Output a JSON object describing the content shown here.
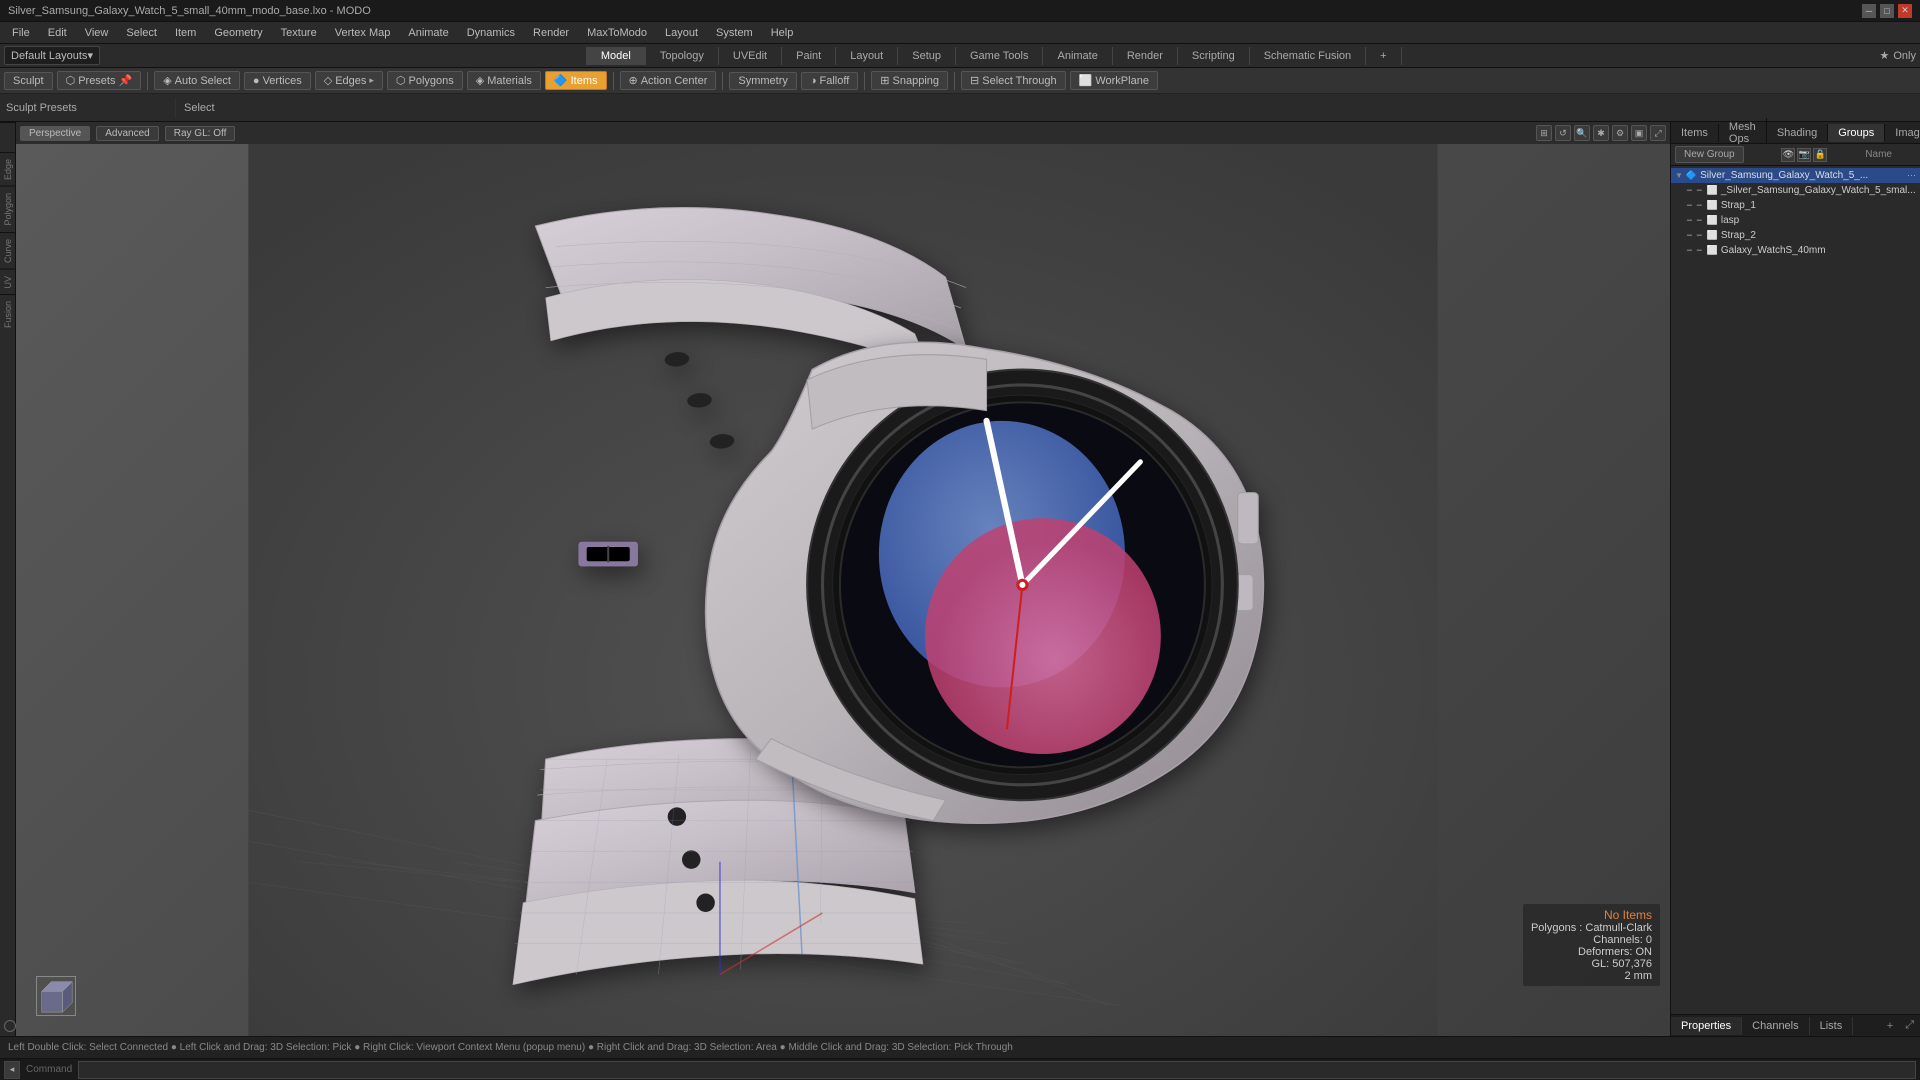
{
  "titleBar": {
    "title": "Silver_Samsung_Galaxy_Watch_5_small_40mm_modo_base.lxo - MODO",
    "minimize": "─",
    "maximize": "□",
    "close": "✕"
  },
  "menuBar": {
    "items": [
      "File",
      "Edit",
      "View",
      "Select",
      "Item",
      "Geometry",
      "Texture",
      "Vertex Map",
      "Animate",
      "Dynamics",
      "Render",
      "MaxToModo",
      "Layout",
      "System",
      "Help"
    ]
  },
  "layoutBar": {
    "defaultLayouts": "Default Layouts",
    "tabs": [
      "Model",
      "Topology",
      "UVEdit",
      "Paint",
      "Layout",
      "Setup",
      "Game Tools",
      "Animate",
      "Render",
      "Scripting",
      "Schematic Fusion"
    ],
    "activeTab": "Model",
    "star": "★",
    "onlyLabel": "Only"
  },
  "toolBar": {
    "sculpt": "Sculpt",
    "presets": "Presets",
    "autoSelect": "Auto Select",
    "vertices": "Vertices",
    "edges": "Edges",
    "polygons": "Polygons",
    "materials": "Materials",
    "items": "Items",
    "actionCenter": "Action Center",
    "symmetry": "Symmetry",
    "falloff": "Falloff",
    "snapping": "Snapping",
    "selectThrough": "Select Through",
    "workPlane": "WorkPlane"
  },
  "sculptPresetsPanel": {
    "label": "Sculpt Presets",
    "selectLabel": "Select"
  },
  "itemsPanel": {
    "label": "Items",
    "items": [
      "Silver_Samsung_Galaxy_Watch_5_small",
      "Strap_1",
      "lasp",
      "Strap_2",
      "Galaxy_WatchS_40mm"
    ]
  },
  "viewport": {
    "perspective": "Perspective",
    "advanced": "Advanced",
    "rayGL": "Ray GL: Off"
  },
  "rightPanel": {
    "tabs": [
      "Items",
      "Mesh Ops",
      "Shading",
      "Groups",
      "Images"
    ],
    "activeTab": "Groups",
    "newGroupBtn": "New Group",
    "nameLabel": "Name",
    "sceneItems": [
      {
        "name": "Silver_Samsung_Galaxy_Watch_5_...",
        "indent": 0,
        "hasArrow": true,
        "selected": true
      },
      {
        "name": "_Silver_Samsung_Galaxy_Watch_5_smal...",
        "indent": 1,
        "hasArrow": false
      },
      {
        "name": "Strap_1",
        "indent": 1,
        "hasArrow": false
      },
      {
        "name": "lasp",
        "indent": 1,
        "hasArrow": false
      },
      {
        "name": "Strap_2",
        "indent": 1,
        "hasArrow": false
      },
      {
        "name": "Galaxy_WatchS_40mm",
        "indent": 1,
        "hasArrow": false
      }
    ],
    "bottomTabs": [
      "Properties",
      "Channels",
      "Lists"
    ],
    "activeBottomTab": "Properties",
    "plusBtn": "+",
    "expandBtn": "⤢"
  },
  "stats": {
    "noItems": "No Items",
    "polygons": "Polygons : Catmull-Clark",
    "channels": "Channels: 0",
    "deformers": "Deformers: ON",
    "gl": "GL: 507,376",
    "distance": "2 mm"
  },
  "statusBar": {
    "text": "Left Double Click: Select Connected ● Left Click and Drag: 3D Selection: Pick ● Right Click: Viewport Context Menu (popup menu) ● Right Click and Drag: 3D Selection: Area ● Middle Click and Drag: 3D Selection: Pick Through"
  },
  "commandBar": {
    "label": "Command",
    "placeholder": "",
    "expandIcon": "◂"
  },
  "leftStrip": {
    "tabs": [
      "",
      "Edge",
      "Polygon",
      "Curve",
      "UV",
      "Fusion"
    ]
  }
}
